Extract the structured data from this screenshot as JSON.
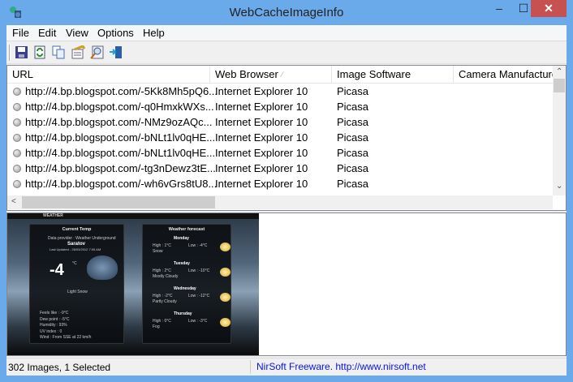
{
  "window": {
    "title": "WebCacheImageInfo",
    "minimize": "‒",
    "maximize": "☐",
    "close": "✕"
  },
  "menu": [
    "File",
    "Edit",
    "View",
    "Options",
    "Help"
  ],
  "toolbar": [
    "save-icon",
    "refresh-icon",
    "copy-icon",
    "properties-icon",
    "find-icon",
    "exit-icon"
  ],
  "columns": [
    "URL",
    "Web Browser",
    "Image Software",
    "Camera Manufacturer"
  ],
  "rows": [
    {
      "url": "http://4.bp.blogspot.com/-5Kk8Mh5pQ6...",
      "browser": "Internet Explorer 10",
      "software": "Picasa"
    },
    {
      "url": "http://4.bp.blogspot.com/-q0HmxkWXs...",
      "browser": "Internet Explorer 10",
      "software": "Picasa"
    },
    {
      "url": "http://4.bp.blogspot.com/-NMz9ozAQc...",
      "browser": "Internet Explorer 10",
      "software": "Picasa"
    },
    {
      "url": "http://4.bp.blogspot.com/-bNLt1lv0qHE...",
      "browser": "Internet Explorer 10",
      "software": "Picasa"
    },
    {
      "url": "http://4.bp.blogspot.com/-bNLt1lv0qHE...",
      "browser": "Internet Explorer 10",
      "software": "Picasa"
    },
    {
      "url": "http://4.bp.blogspot.com/-tg3nDewz3tE...",
      "browser": "Internet Explorer 10",
      "software": "Picasa"
    },
    {
      "url": "http://4.bp.blogspot.com/-wh6vGrs8tU8...",
      "browser": "Internet Explorer 10",
      "software": "Picasa"
    }
  ],
  "preview": {
    "tab": "WEATHER",
    "current": {
      "title": "Current Temp",
      "provider": "Data provider : Weather Underground",
      "city": "Saratov",
      "updated": "Last Updated - 26/03/2012 7:05 AM",
      "temp": "-4",
      "unit": "°C",
      "condition": "Light Snow",
      "details": [
        "Feels like :  -9°C",
        "Dew point :  -5°C",
        "Humidity :  93%",
        "UV index :  0",
        "Wind :  From SSE at 22 km/h"
      ]
    },
    "forecast": {
      "title": "Weather forecast",
      "days": [
        {
          "day": "Monday",
          "high": "High : 1°C",
          "low": "Low : -4°C",
          "cond": "Snow"
        },
        {
          "day": "Tuesday",
          "high": "High : 2°C",
          "low": "Low : -10°C",
          "cond": "Mostly Cloudy"
        },
        {
          "day": "Wednesday",
          "high": "High : -2°C",
          "low": "Low : -12°C",
          "cond": "Partly Cloudy"
        },
        {
          "day": "Thursday",
          "high": "High : 0°C",
          "low": "Low : -3°C",
          "cond": "Fog"
        }
      ]
    }
  },
  "status": {
    "left": "302 Images, 1 Selected",
    "right": "NirSoft Freeware.  http://www.nirsoft.net"
  }
}
